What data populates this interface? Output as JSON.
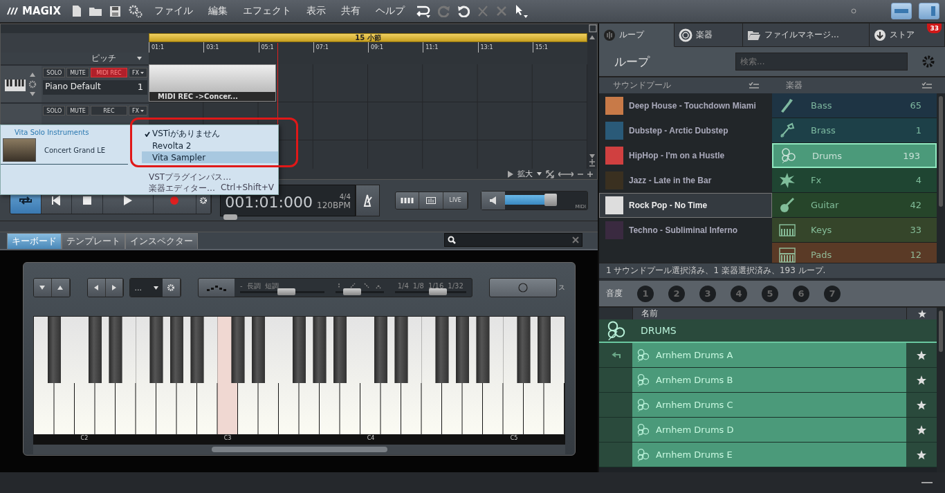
{
  "app": {
    "logo": "MAGIX"
  },
  "menu": [
    "ファイル",
    "編集",
    "エフェクト",
    "表示",
    "共有",
    "ヘルプ"
  ],
  "arranger": {
    "loop_range": "15 小節",
    "ruler": [
      "01:1",
      "03:1",
      "05:1",
      "07:1",
      "09:1",
      "11:1",
      "13:1",
      "15:1"
    ],
    "pitch_label": "ピッチ",
    "tracks": [
      {
        "name": "Piano Default",
        "number": "1",
        "buttons": [
          {
            "label": "SOLO",
            "on": false
          },
          {
            "label": "MUTE",
            "on": false
          },
          {
            "label": "MIDI REC",
            "on": true
          },
          {
            "label": "FX"
          }
        ]
      },
      {
        "buttons": [
          {
            "label": "SOLO",
            "on": false
          },
          {
            "label": "MUTE",
            "on": false
          },
          {
            "label": "REC",
            "on": false
          },
          {
            "label": "FX"
          }
        ]
      }
    ],
    "clip": {
      "title": "MIDI REC ->Concer..."
    },
    "zoom_label": "拡大"
  },
  "popup": {
    "category": "Vita Solo Instruments",
    "instrument": "Concert Grand LE",
    "items": [
      {
        "label": "VSTiがありません",
        "checked": true,
        "selected": false
      },
      {
        "label": "Revolta 2",
        "checked": false,
        "selected": false
      },
      {
        "label": "Vita Sampler",
        "checked": false,
        "selected": true
      }
    ],
    "footer": [
      {
        "label": "VSTプラグインパス…"
      },
      {
        "label": "楽器エディター…",
        "shortcut": "Ctrl+Shift+V"
      }
    ]
  },
  "transport": {
    "loop_on": true,
    "time": "001:01:000",
    "signature": "4/4",
    "tempo": "120BPM",
    "views": [
      "LIVE"
    ],
    "volume": {
      "level": 0.55,
      "label": "MIDI"
    }
  },
  "keyboard_panel": {
    "tabs": [
      {
        "label": "キーボード",
        "selected": true
      },
      {
        "label": "テンプレート",
        "selected": false
      },
      {
        "label": "インスペクター",
        "selected": false
      }
    ],
    "preset": "...",
    "scale_labels": [
      "-",
      "長調",
      "短調"
    ],
    "note_values": [
      "1/4",
      "1/8",
      "1/16",
      "1/32"
    ],
    "scale_slider": {
      "level": 0.55
    },
    "pattern_slider": {
      "level": 0.35
    },
    "note_slider": {
      "level": 0.6
    },
    "edge_label": "ス",
    "white_keys": [
      {
        "pressed": false
      },
      {
        "pressed": false
      },
      {
        "label": "C2",
        "pressed": false
      },
      {
        "pressed": false
      },
      {
        "pressed": false
      },
      {
        "pressed": false
      },
      {
        "pressed": false
      },
      {
        "pressed": false
      },
      {
        "pressed": false
      },
      {
        "label": "C3",
        "pressed": true
      },
      {
        "pressed": false
      },
      {
        "pressed": false
      },
      {
        "pressed": false
      },
      {
        "pressed": false
      },
      {
        "pressed": false
      },
      {
        "pressed": false
      },
      {
        "label": "C4",
        "pressed": false
      },
      {
        "pressed": false
      },
      {
        "pressed": false
      },
      {
        "pressed": false
      },
      {
        "pressed": false
      },
      {
        "pressed": false
      },
      {
        "pressed": false
      },
      {
        "label": "C5",
        "pressed": false
      },
      {
        "pressed": false
      },
      {
        "pressed": false
      }
    ]
  },
  "browser": {
    "tabs": [
      {
        "label": "ループ",
        "selected": true
      },
      {
        "label": "楽器",
        "selected": false
      },
      {
        "label": "ファイルマネージ...",
        "selected": false
      },
      {
        "label": "ストア",
        "selected": false,
        "badge": "33"
      }
    ],
    "title": "ループ",
    "search": {
      "placeholder": "検索..."
    },
    "columns": [
      "サウンドプール",
      "楽器"
    ],
    "soundpools": [
      {
        "name": "Deep House - Touchdown Miami",
        "selected": false
      },
      {
        "name": "Dubstep - Arctic Dubstep",
        "selected": false
      },
      {
        "name": "HipHop - I'm on a Hustle",
        "selected": false
      },
      {
        "name": "Jazz - Late in the Bar",
        "selected": false
      },
      {
        "name": "Rock Pop - No Time",
        "selected": true
      },
      {
        "name": "Techno - Subliminal Inferno",
        "selected": false
      }
    ],
    "instruments": [
      {
        "name": "Bass",
        "count": "65",
        "color": "#1e3444",
        "selected": false
      },
      {
        "name": "Brass",
        "count": "1",
        "color": "#1d4048",
        "selected": false
      },
      {
        "name": "Drums",
        "count": "193",
        "color": "#4b9a7a",
        "selected": true
      },
      {
        "name": "Fx",
        "count": "4",
        "color": "#1f4532",
        "selected": false
      },
      {
        "name": "Guitar",
        "count": "42",
        "color": "#26452a",
        "selected": false
      },
      {
        "name": "Keys",
        "count": "33",
        "color": "#35452a",
        "selected": false
      },
      {
        "name": "Pads",
        "count": "12",
        "color": "#5a3a26",
        "selected": false
      }
    ],
    "status": "1 サウンドプール選択済み、1 楽器選択済み、193 ループ.",
    "degree": {
      "label": "音度",
      "buttons": [
        "1",
        "2",
        "3",
        "4",
        "5",
        "6",
        "7"
      ]
    },
    "loop_list": {
      "column": "名前",
      "group": "DRUMS",
      "rows": [
        {
          "name": "Arnhem Drums A",
          "playing": true
        },
        {
          "name": "Arnhem Drums B",
          "playing": false
        },
        {
          "name": "Arnhem Drums C",
          "playing": false
        },
        {
          "name": "Arnhem Drums D",
          "playing": false
        },
        {
          "name": "Arnhem Drums E",
          "playing": false
        }
      ]
    }
  }
}
